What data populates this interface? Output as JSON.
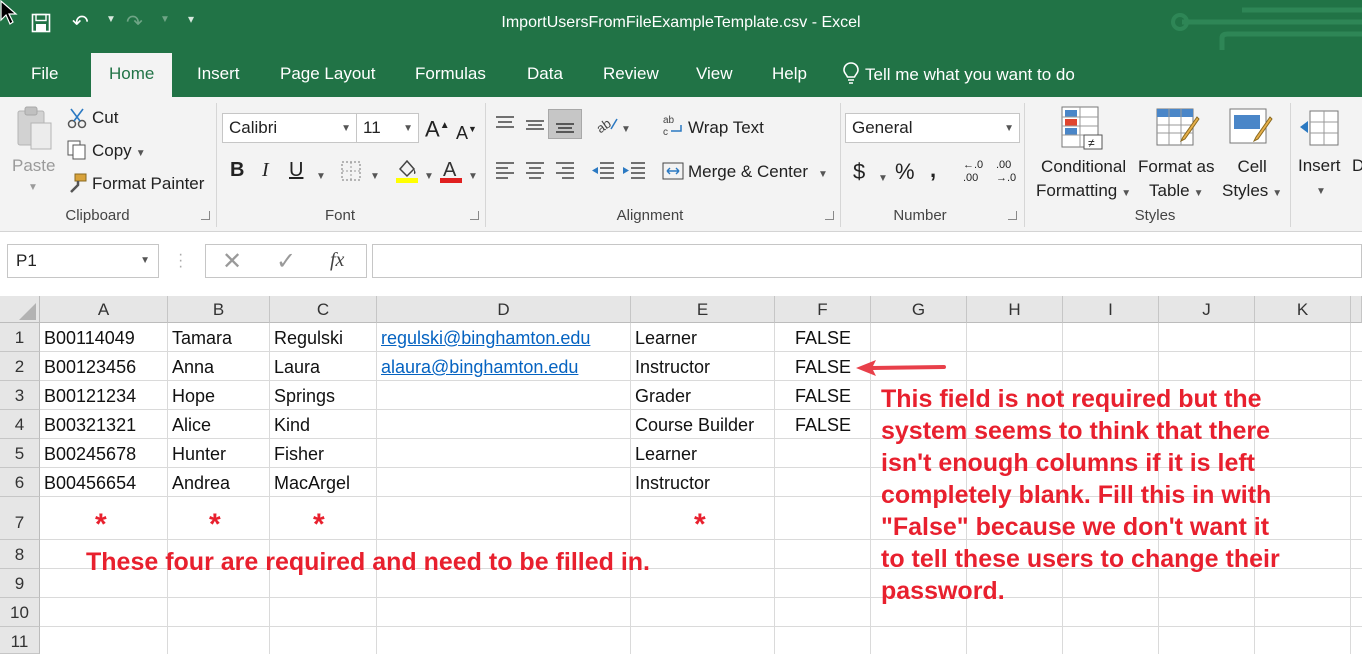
{
  "window": {
    "title": "ImportUsersFromFileExampleTemplate.csv  -  Excel"
  },
  "tabs": [
    "File",
    "Home",
    "Insert",
    "Page Layout",
    "Formulas",
    "Data",
    "Review",
    "View",
    "Help"
  ],
  "active_tab": "Home",
  "tell_me": "Tell me what you want to do",
  "ribbon": {
    "clipboard": {
      "paste": "Paste",
      "cut": "Cut",
      "copy": "Copy",
      "format_painter": "Format Painter",
      "label": "Clipboard"
    },
    "font": {
      "name": "Calibri",
      "size": "11",
      "label": "Font"
    },
    "alignment": {
      "wrap_text": "Wrap Text",
      "merge_center": "Merge & Center",
      "label": "Alignment"
    },
    "number": {
      "format": "General",
      "label": "Number"
    },
    "styles": {
      "conditional_1": "Conditional",
      "conditional_2": "Formatting",
      "format_table_1": "Format as",
      "format_table_2": "Table",
      "cell_styles_1": "Cell",
      "cell_styles_2": "Styles",
      "label": "Styles"
    },
    "cells": {
      "insert": "Insert",
      "cut_off": "D"
    }
  },
  "formula_bar": {
    "name_box": "P1",
    "fx": "fx",
    "value": ""
  },
  "sheet": {
    "columns": [
      "A",
      "B",
      "C",
      "D",
      "E",
      "F",
      "G",
      "H",
      "I",
      "J",
      "K"
    ],
    "rows": [
      "1",
      "2",
      "3",
      "4",
      "5",
      "6",
      "7",
      "8",
      "9",
      "10",
      "11"
    ],
    "data": [
      [
        "B00114049",
        "Tamara",
        "Regulski",
        "regulski@binghamton.edu",
        "Learner",
        "FALSE"
      ],
      [
        "B00123456",
        "Anna",
        "Laura",
        "alaura@binghamton.edu",
        "Instructor",
        "FALSE"
      ],
      [
        "B00121234",
        "Hope",
        "Springs",
        "",
        "Grader",
        "FALSE"
      ],
      [
        "B00321321",
        "Alice",
        "Kind",
        "",
        "Course Builder",
        "FALSE"
      ],
      [
        "B00245678",
        "Hunter",
        "Fisher",
        "",
        "Learner",
        ""
      ],
      [
        "B00456654",
        "Andrea",
        "MacArgel",
        "",
        "Instructor",
        ""
      ]
    ],
    "required_marker": "*"
  },
  "annotations": {
    "required_note": "These four are required and need to be filled in.",
    "false_note": [
      "This field is not required but the",
      "system seems to think that there",
      "isn't enough columns if it is left",
      "completely blank. Fill this in with",
      "\"False\" because we don't want it",
      "to tell these users to change their",
      "password."
    ]
  },
  "colors": {
    "excel_green": "#217346",
    "annotation_red": "#e8202e",
    "link_blue": "#0563c1"
  }
}
